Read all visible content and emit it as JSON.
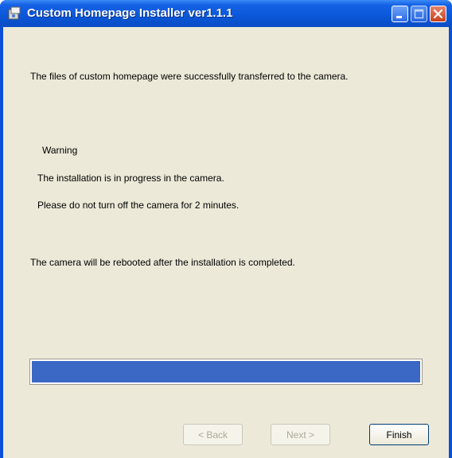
{
  "window": {
    "title": "Custom Homepage Installer ver1.1.1"
  },
  "messages": {
    "success": "The files of custom homepage were successfully transferred to the camera.",
    "warning_heading": "Warning",
    "warning_line1": "The installation is in progress in the camera.",
    "warning_line2": "Please do not turn off the camera for 2 minutes.",
    "reboot_note": "The camera will be rebooted after the installation is completed."
  },
  "progress": {
    "value": 1.0
  },
  "buttons": {
    "back": "< Back",
    "next": "Next >",
    "finish": "Finish"
  },
  "colors": {
    "titlebar": "#0b57d8",
    "client_bg": "#ece9d8",
    "progress_fill": "#3a68c4"
  }
}
